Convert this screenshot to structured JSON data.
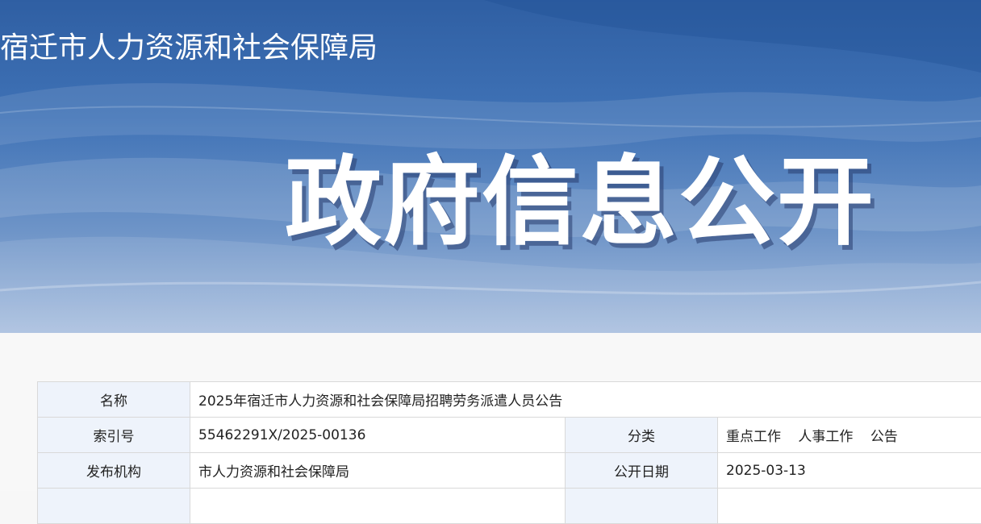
{
  "header": {
    "agency_name": "宿迁市人力资源和社会保障局",
    "headline": "政府信息公开"
  },
  "info_table": {
    "name_label": "名称",
    "name_value": "2025年宿迁市人力资源和社会保障局招聘劳务派遣人员公告",
    "index_label": "索引号",
    "index_value": "55462291X/2025-00136",
    "category_label": "分类",
    "category_values": [
      "重点工作",
      "人事工作",
      "公告"
    ],
    "publisher_label": "发布机构",
    "publisher_value": "市人力资源和社会保障局",
    "date_label": "公开日期",
    "date_value": "2025-03-13"
  }
}
